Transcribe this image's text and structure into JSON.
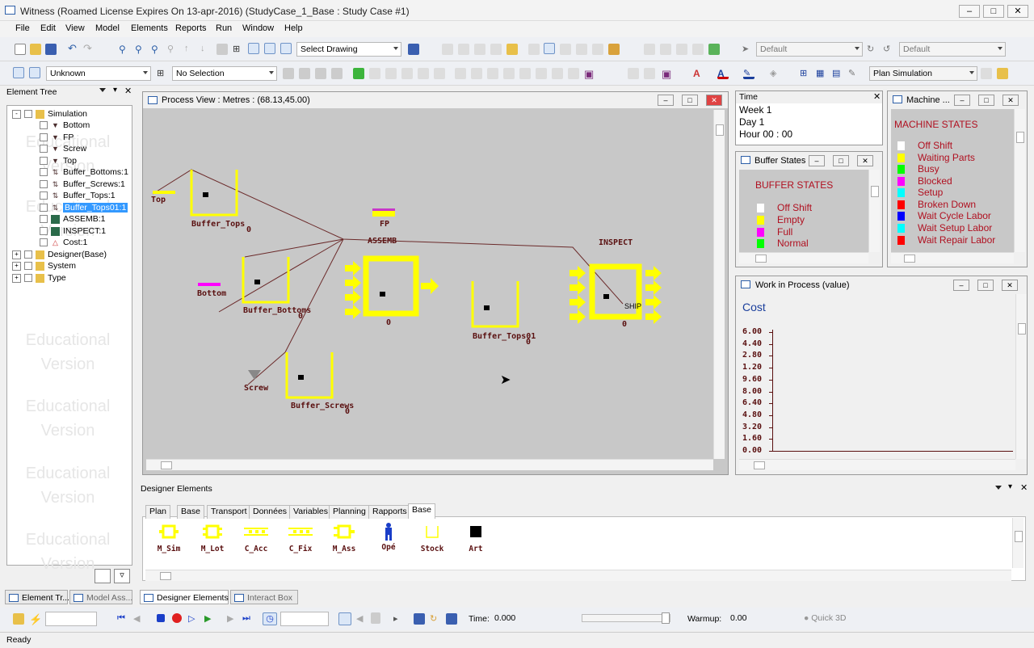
{
  "window": {
    "title": "Witness (Roamed License Expires On 13-apr-2016) (StudyCase_1_Base : Study Case #1)"
  },
  "menu": [
    "File",
    "Edit",
    "View",
    "Model",
    "Elements",
    "Reports",
    "Run",
    "Window",
    "Help"
  ],
  "toolbar1": {
    "select_drawing": "Select Drawing",
    "default1": "Default",
    "default2": "Default"
  },
  "toolbar2": {
    "unknown": "Unknown",
    "no_selection": "No Selection",
    "plan_simulation": "Plan Simulation"
  },
  "element_tree": {
    "title": "Element Tree",
    "items": [
      {
        "label": "Simulation"
      },
      {
        "label": "Bottom"
      },
      {
        "label": "FP"
      },
      {
        "label": "Screw"
      },
      {
        "label": "Top"
      },
      {
        "label": "Buffer_Bottoms:1"
      },
      {
        "label": "Buffer_Screws:1"
      },
      {
        "label": "Buffer_Tops:1"
      },
      {
        "label": "Buffer_Tops01:1"
      },
      {
        "label": "ASSEMB:1"
      },
      {
        "label": "INSPECT:1"
      },
      {
        "label": "Cost:1"
      },
      {
        "label": "Designer(Base)"
      },
      {
        "label": "System"
      },
      {
        "label": "Type"
      }
    ],
    "watermark": "Educational Version"
  },
  "process_view": {
    "title": "Process View : Metres : (68.13,45.00)",
    "labels": {
      "top": "Top",
      "buffer_tops": "Buffer_Tops",
      "fp": "FP",
      "assemb": "ASSEMB",
      "inspect": "INSPECT",
      "bottom": "Bottom",
      "buffer_bottoms": "Buffer_Bottoms",
      "buffer_tops01": "Buffer_Tops01",
      "screw": "Screw",
      "buffer_screws": "Buffer_Screws",
      "ship": "SHIP",
      "zero": "0"
    }
  },
  "time_panel": {
    "title": "Time",
    "week": "Week 1",
    "day": "Day 1",
    "hour": "Hour 00 : 00"
  },
  "buffer_states": {
    "window_title": "Buffer States",
    "heading": "BUFFER STATES",
    "items": [
      {
        "label": "Off Shift",
        "color": "#ffffff"
      },
      {
        "label": "Empty",
        "color": "#ffff00"
      },
      {
        "label": "Full",
        "color": "#ff00ff"
      },
      {
        "label": "Normal",
        "color": "#00ff00"
      }
    ]
  },
  "machine_states": {
    "window_title": "Machine ...",
    "heading": "MACHINE STATES",
    "items": [
      {
        "label": "Off Shift",
        "color": "#ffffff"
      },
      {
        "label": "Waiting Parts",
        "color": "#ffff00"
      },
      {
        "label": "Busy",
        "color": "#00ff00"
      },
      {
        "label": "Blocked",
        "color": "#ff00ff"
      },
      {
        "label": "Setup",
        "color": "#00ffff"
      },
      {
        "label": "Broken Down",
        "color": "#ff0000"
      },
      {
        "label": "Wait Cycle Labor",
        "color": "#0000ff"
      },
      {
        "label": "Wait Setup Labor",
        "color": "#00ffff"
      },
      {
        "label": "Wait Repair Labor",
        "color": "#ff0000"
      }
    ]
  },
  "wip": {
    "window_title": "Work in Process (value)",
    "heading": "Cost",
    "ticks": [
      "6.00",
      "4.40",
      "2.80",
      "1.20",
      "9.60",
      "8.00",
      "6.40",
      "4.80",
      "3.20",
      "1.60",
      "0.00"
    ]
  },
  "designer": {
    "title": "Designer Elements",
    "tabs": [
      "Plan",
      "Base",
      "Transport",
      "Données",
      "Variables",
      "Planning",
      "Rapports",
      "Base"
    ],
    "active_tab": 7,
    "items": [
      "M_Sim",
      "M_Lot",
      "C_Acc",
      "C_Fix",
      "M_Ass",
      "Opé",
      "Stock",
      "Art"
    ]
  },
  "bottom_tabs": {
    "element_tree": "Element Tr...",
    "model_assistant": "Model Ass...",
    "designer_elements": "Designer Elements",
    "interact_box": "Interact Box"
  },
  "run_bar": {
    "time_label": "Time:",
    "time_value": "0.000",
    "warmup_label": "Warmup:",
    "warmup_value": "0.00",
    "quick3d": "Quick 3D"
  },
  "status": "Ready"
}
